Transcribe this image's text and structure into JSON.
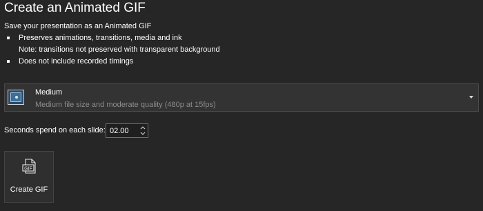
{
  "header": {
    "title": "Create an Animated GIF"
  },
  "intro": {
    "text": "Save your presentation as an Animated GIF"
  },
  "bullets": [
    "Preserves animations, transitions, media and ink",
    "Note: transitions not preserved with transparent background",
    "Does not include recorded timings"
  ],
  "quality": {
    "name": "Medium",
    "description": "Medium file size and moderate quality (480p at 15fps)",
    "icon": "screen-quality-icon"
  },
  "seconds": {
    "label": "Seconds spend on each slide:",
    "value": "02.00"
  },
  "create_button": {
    "label": "Create GIF",
    "icon": "gif-file-icon"
  },
  "colors": {
    "background": "#262626",
    "panel": "#333333",
    "text": "#ffffff",
    "muted_text": "#8c8c8c"
  }
}
